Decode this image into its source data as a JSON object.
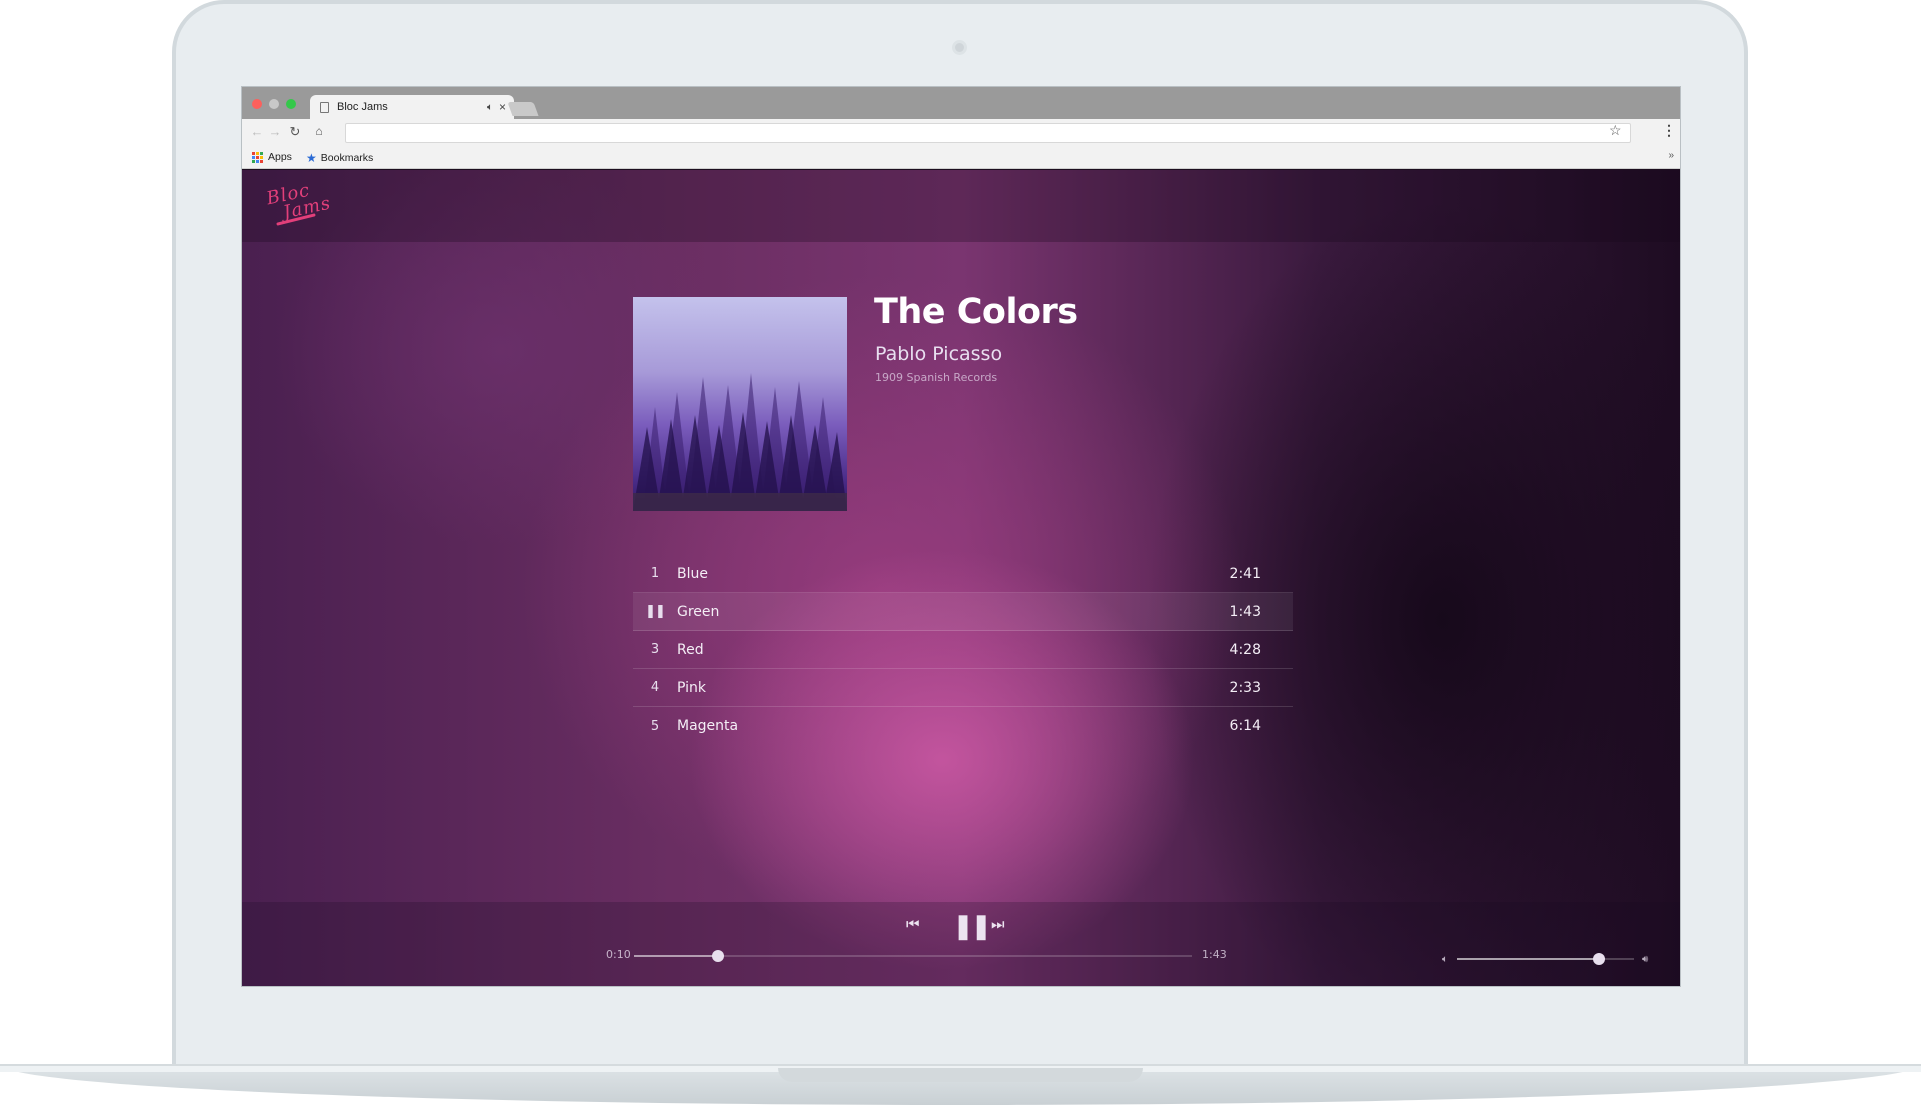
{
  "browser": {
    "tab_title": "Bloc Jams",
    "url": "",
    "bookmarks": [
      {
        "label": "Apps",
        "icon": "apps-grid-icon"
      },
      {
        "label": "Bookmarks",
        "icon": "star-icon"
      }
    ],
    "overflow_label": "»"
  },
  "app": {
    "logo_text": "Bloc Jams",
    "accent_color": "#e23f7a"
  },
  "album": {
    "title": "The Colors",
    "artist": "Pablo Picasso",
    "release_info": "1909 Spanish Records"
  },
  "songs": [
    {
      "number": "1",
      "title": "Blue",
      "duration": "2:41",
      "playing": false
    },
    {
      "number": "2",
      "title": "Green",
      "duration": "1:43",
      "playing": true
    },
    {
      "number": "3",
      "title": "Red",
      "duration": "4:28",
      "playing": false
    },
    {
      "number": "4",
      "title": "Pink",
      "duration": "2:33",
      "playing": false
    },
    {
      "number": "5",
      "title": "Magenta",
      "duration": "6:14",
      "playing": false
    }
  ],
  "player": {
    "current_time": "0:10",
    "total_time": "1:43",
    "seek_fraction": 0.15,
    "volume_fraction": 0.8,
    "prev_icon": "previous-icon",
    "play_state_icon": "pause-icon",
    "next_icon": "next-icon"
  }
}
